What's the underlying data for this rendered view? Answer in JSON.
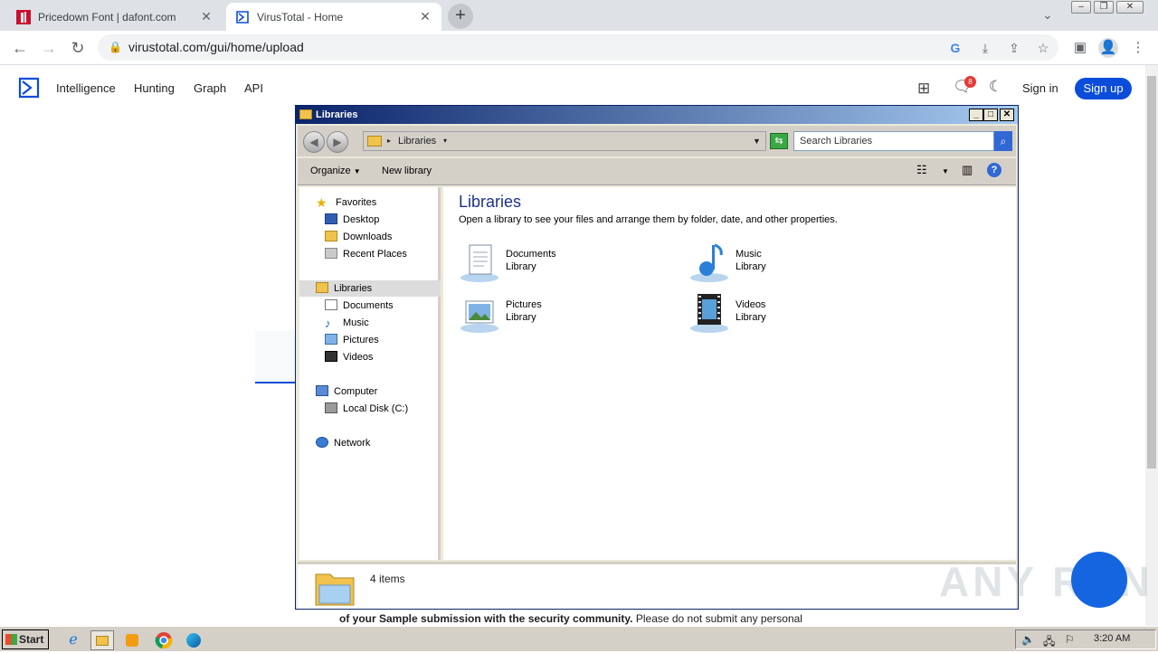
{
  "browser": {
    "tabs": [
      {
        "title": "Pricedown Font | dafont.com",
        "active": false
      },
      {
        "title": "VirusTotal - Home",
        "active": true
      }
    ],
    "url": "virustotal.com/gui/home/upload",
    "new_tab_label": "+"
  },
  "virustotal": {
    "nav": [
      "Intelligence",
      "Hunting",
      "Graph",
      "API"
    ],
    "notification_count": "8",
    "sign_in": "Sign in",
    "sign_up": "Sign up",
    "footer_text_bold": "of your Sample submission with the security community.",
    "footer_text": " Please do not submit any personal"
  },
  "explorer": {
    "window_title": "Libraries",
    "address_crumb": "Libraries",
    "search_placeholder": "Search Libraries",
    "commands": {
      "organize": "Organize",
      "new_library": "New library"
    },
    "tree": {
      "favorites": "Favorites",
      "desktop": "Desktop",
      "downloads": "Downloads",
      "recent": "Recent Places",
      "libraries": "Libraries",
      "documents": "Documents",
      "music": "Music",
      "pictures": "Pictures",
      "videos": "Videos",
      "computer": "Computer",
      "local_disk": "Local Disk (C:)",
      "network": "Network"
    },
    "heading": "Libraries",
    "subheading": "Open a library to see your files and arrange them by folder, date, and other properties.",
    "libraries": [
      {
        "name": "Documents",
        "type": "Library"
      },
      {
        "name": "Music",
        "type": "Library"
      },
      {
        "name": "Pictures",
        "type": "Library"
      },
      {
        "name": "Videos",
        "type": "Library"
      }
    ],
    "status": "4 items"
  },
  "taskbar": {
    "start": "Start",
    "clock": "3:20 AM"
  },
  "watermark": "ANY RUN",
  "colors": {
    "vt_blue": "#0b4dda",
    "title_bar": "#0a246a",
    "taskbar": "#d4d0c8"
  }
}
